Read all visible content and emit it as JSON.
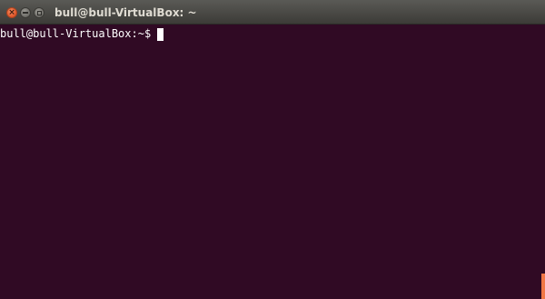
{
  "window": {
    "title": "bull@bull-VirtualBox: ~",
    "controls": {
      "close_icon": "×",
      "minimize_icon": "minimize-icon",
      "maximize_icon": "maximize-icon"
    }
  },
  "terminal": {
    "prompt": "bull@bull-VirtualBox:~$",
    "input": "",
    "background_color": "#300a24",
    "text_color": "#ffffff"
  },
  "scrollbar": {
    "thumb_color": "#f07746"
  }
}
